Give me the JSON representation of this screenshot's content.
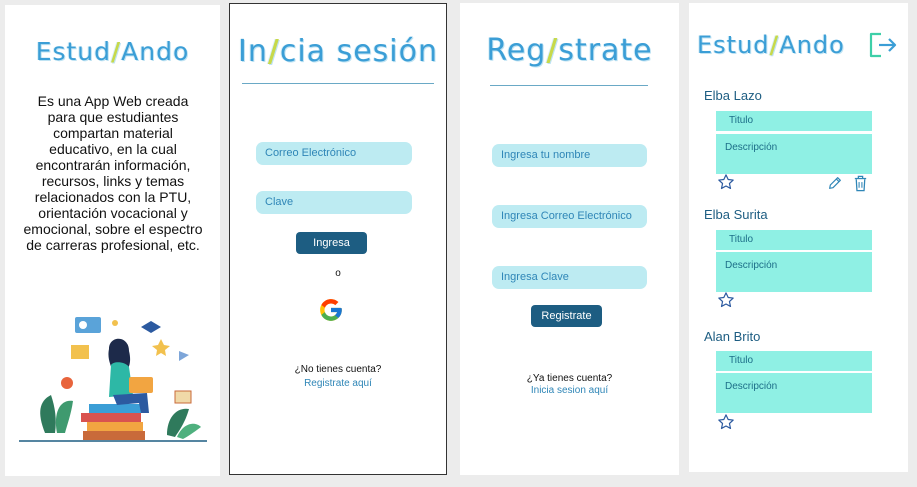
{
  "intro_screen": {
    "logo_left": "Estud",
    "logo_slash": "/",
    "logo_right": "Ando",
    "description": "Es una App Web creada para que estudiantes compartan material educativo, en la cual encontrarán información, recursos, links y temas relacionados con la PTU, orientación vocacional y emocional, sobre el espectro de carreras profesional, etc."
  },
  "login_screen": {
    "title_left": "In",
    "title_slash": "/",
    "title_right": "cia sesión",
    "email_placeholder": "Correo Electrónico",
    "password_placeholder": "Clave",
    "login_button": "Ingresa",
    "or_text": "o",
    "no_account_text": "¿No tienes cuenta?",
    "register_link": "Registrate aquí"
  },
  "register_screen": {
    "title_left": "Reg",
    "title_slash": "/",
    "title_right": "strate",
    "name_placeholder": "Ingresa tu nombre",
    "email_placeholder": "Ingresa Correo Electrónico",
    "password_placeholder": "Ingresa Clave",
    "register_button": "Registrate",
    "have_account_text": "¿Ya tienes cuenta?",
    "login_link": "Inicia sesion aquí"
  },
  "feed_screen": {
    "logo_left": "Estud",
    "logo_slash": "/",
    "logo_right": "Ando",
    "posts": [
      {
        "author": "Elba Lazo",
        "title_placeholder": "Titulo",
        "description_placeholder": "Descripción"
      },
      {
        "author": "Elba Surita",
        "title_placeholder": "Titulo",
        "description_placeholder": "Descripción"
      },
      {
        "author": "Alan Brito",
        "title_placeholder": "Titulo",
        "description_placeholder": "Descripción"
      }
    ]
  },
  "colors": {
    "brand_blue": "#3b9ed6",
    "accent_lime": "#c7d94a",
    "field_bg": "#bdebf2",
    "button_bg": "#1d5d82",
    "card_bg": "#8ff0e4",
    "logout_green": "#3ecfa8"
  },
  "icons": [
    "google-icon",
    "logout-icon",
    "star-icon",
    "pencil-icon",
    "trash-icon",
    "student-illustration"
  ]
}
